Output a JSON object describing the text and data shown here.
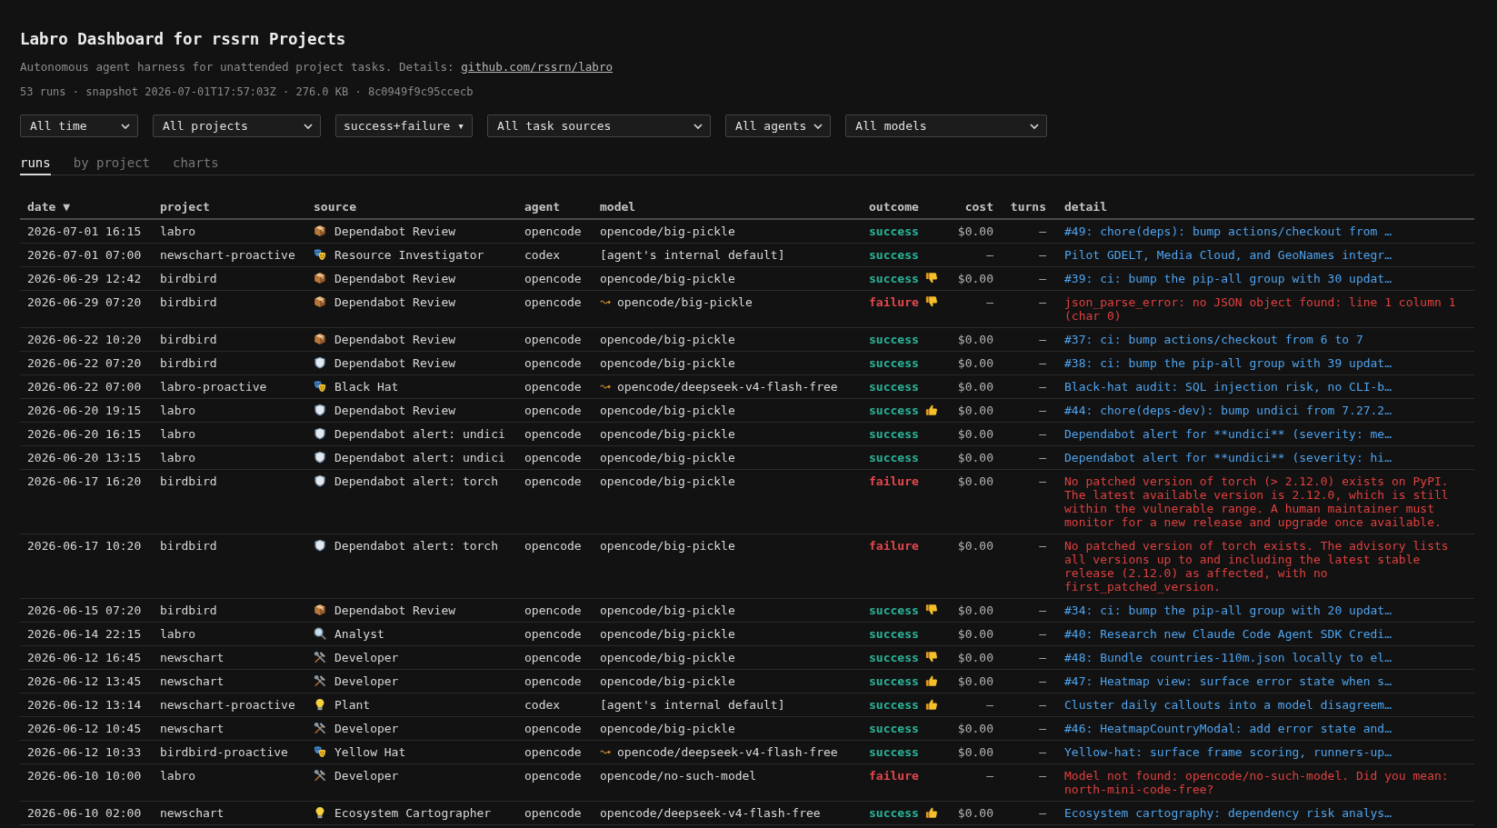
{
  "title": "Labro Dashboard for rssrn Projects",
  "description": {
    "text": "Autonomous agent harness for unattended project tasks. Details: ",
    "link": "github.com/rssrn/labro"
  },
  "snapshot": "53 runs · snapshot 2026-07-01T17:57:03Z · 276.0 KB · 8c0949f9c95ccecb",
  "filters": [
    {
      "kind": "select",
      "value": "All time"
    },
    {
      "kind": "select",
      "value": "All projects"
    },
    {
      "kind": "menu",
      "value": "success+failure ▾"
    },
    {
      "kind": "select",
      "value": "All task sources"
    },
    {
      "kind": "select",
      "value": "All agents"
    },
    {
      "kind": "select",
      "value": "All models"
    }
  ],
  "tabs": [
    {
      "label": "runs",
      "selected": true
    },
    {
      "label": "by project",
      "selected": false
    },
    {
      "label": "charts",
      "selected": false
    }
  ],
  "table": {
    "columns": [
      {
        "label": "date ▼",
        "kind": "text"
      },
      {
        "label": "project",
        "kind": "text"
      },
      {
        "label": "source",
        "kind": "text"
      },
      {
        "label": "agent",
        "kind": "text"
      },
      {
        "label": "model",
        "kind": "text"
      },
      {
        "label": "outcome",
        "kind": "text"
      },
      {
        "label": "cost",
        "kind": "number"
      },
      {
        "label": "turns",
        "kind": "number"
      },
      {
        "label": "detail",
        "kind": "text"
      }
    ],
    "rows": [
      {
        "date": "2026-07-01 16:15",
        "project": "labro",
        "source": {
          "kind": "package",
          "label": "Dependabot Review"
        },
        "agent": "opencode",
        "fallback": false,
        "model": "opencode/big-pickle",
        "outcome": "success",
        "failed": false,
        "liked": false,
        "disliked": false,
        "cost": "$0.00",
        "turns": "—",
        "detail": "#49: chore(deps): bump actions/checkout from …"
      },
      {
        "date": "2026-07-01 07:00",
        "project": "newschart-proactive",
        "source": {
          "kind": "masks",
          "label": "Resource Investigator"
        },
        "agent": "codex",
        "fallback": false,
        "model": "[agent's internal default]",
        "outcome": "success",
        "failed": false,
        "liked": false,
        "disliked": false,
        "cost": "—",
        "turns": "—",
        "detail": "Pilot GDELT, Media Cloud, and GeoNames integr…"
      },
      {
        "date": "2026-06-29 12:42",
        "project": "birdbird",
        "source": {
          "kind": "package",
          "label": "Dependabot Review"
        },
        "agent": "opencode",
        "fallback": false,
        "model": "opencode/big-pickle",
        "outcome": "success",
        "failed": false,
        "liked": false,
        "disliked": true,
        "cost": "$0.00",
        "turns": "—",
        "detail": "#39: ci: bump the pip-all group with 30 updat…"
      },
      {
        "date": "2026-06-29 07:20",
        "project": "birdbird",
        "source": {
          "kind": "package",
          "label": "Dependabot Review"
        },
        "agent": "opencode",
        "fallback": true,
        "model": "opencode/big-pickle",
        "outcome": "failure",
        "failed": true,
        "liked": false,
        "disliked": true,
        "cost": "—",
        "turns": "—",
        "detail": "json_parse_error: no JSON object found: line 1 column 1 (char 0)"
      },
      {
        "date": "2026-06-22 10:20",
        "project": "birdbird",
        "source": {
          "kind": "package",
          "label": "Dependabot Review"
        },
        "agent": "opencode",
        "fallback": false,
        "model": "opencode/big-pickle",
        "outcome": "success",
        "failed": false,
        "liked": false,
        "disliked": false,
        "cost": "$0.00",
        "turns": "—",
        "detail": "#37: ci: bump actions/checkout from 6 to 7"
      },
      {
        "date": "2026-06-22 07:20",
        "project": "birdbird",
        "source": {
          "kind": "shield",
          "label": "Dependabot Review"
        },
        "agent": "opencode",
        "fallback": false,
        "model": "opencode/big-pickle",
        "outcome": "success",
        "failed": false,
        "liked": false,
        "disliked": false,
        "cost": "$0.00",
        "turns": "—",
        "detail": "#38: ci: bump the pip-all group with 39 updat…"
      },
      {
        "date": "2026-06-22 07:00",
        "project": "labro-proactive",
        "source": {
          "kind": "masks",
          "label": "Black Hat"
        },
        "agent": "opencode",
        "fallback": true,
        "model": "opencode/deepseek-v4-flash-free",
        "outcome": "success",
        "failed": false,
        "liked": false,
        "disliked": false,
        "cost": "$0.00",
        "turns": "—",
        "detail": "Black-hat audit: SQL injection risk, no CLI-b…"
      },
      {
        "date": "2026-06-20 19:15",
        "project": "labro",
        "source": {
          "kind": "shield",
          "label": "Dependabot Review"
        },
        "agent": "opencode",
        "fallback": false,
        "model": "opencode/big-pickle",
        "outcome": "success",
        "failed": false,
        "liked": true,
        "disliked": false,
        "cost": "$0.00",
        "turns": "—",
        "detail": "#44: chore(deps-dev): bump undici from 7.27.2…"
      },
      {
        "date": "2026-06-20 16:15",
        "project": "labro",
        "source": {
          "kind": "shield",
          "label": "Dependabot alert: undici"
        },
        "agent": "opencode",
        "fallback": false,
        "model": "opencode/big-pickle",
        "outcome": "success",
        "failed": false,
        "liked": false,
        "disliked": false,
        "cost": "$0.00",
        "turns": "—",
        "detail": "Dependabot alert for **undici** (severity: me…"
      },
      {
        "date": "2026-06-20 13:15",
        "project": "labro",
        "source": {
          "kind": "shield",
          "label": "Dependabot alert: undici"
        },
        "agent": "opencode",
        "fallback": false,
        "model": "opencode/big-pickle",
        "outcome": "success",
        "failed": false,
        "liked": false,
        "disliked": false,
        "cost": "$0.00",
        "turns": "—",
        "detail": "Dependabot alert for **undici** (severity: hi…"
      },
      {
        "date": "2026-06-17 16:20",
        "project": "birdbird",
        "source": {
          "kind": "shield",
          "label": "Dependabot alert: torch"
        },
        "agent": "opencode",
        "fallback": false,
        "model": "opencode/big-pickle",
        "outcome": "failure",
        "failed": true,
        "liked": false,
        "disliked": false,
        "cost": "$0.00",
        "turns": "—",
        "detail": "No patched version of torch (> 2.12.0) exists on PyPI. The latest available version is 2.12.0, which is still within the vulnerable range. A human maintainer must monitor for a new release and upgrade once available."
      },
      {
        "date": "2026-06-17 10:20",
        "project": "birdbird",
        "source": {
          "kind": "shield",
          "label": "Dependabot alert: torch"
        },
        "agent": "opencode",
        "fallback": false,
        "model": "opencode/big-pickle",
        "outcome": "failure",
        "failed": true,
        "liked": false,
        "disliked": false,
        "cost": "$0.00",
        "turns": "—",
        "detail": "No patched version of torch exists. The advisory lists all versions up to and including the latest stable release (2.12.0) as affected, with no first_patched_version."
      },
      {
        "date": "2026-06-15 07:20",
        "project": "birdbird",
        "source": {
          "kind": "package",
          "label": "Dependabot Review"
        },
        "agent": "opencode",
        "fallback": false,
        "model": "opencode/big-pickle",
        "outcome": "success",
        "failed": false,
        "liked": false,
        "disliked": true,
        "cost": "$0.00",
        "turns": "—",
        "detail": "#34: ci: bump the pip-all group with 20 updat…"
      },
      {
        "date": "2026-06-14 22:15",
        "project": "labro",
        "source": {
          "kind": "magnifier",
          "label": "Analyst"
        },
        "agent": "opencode",
        "fallback": false,
        "model": "opencode/big-pickle",
        "outcome": "success",
        "failed": false,
        "liked": false,
        "disliked": false,
        "cost": "$0.00",
        "turns": "—",
        "detail": "#40: Research new Claude Code Agent SDK Credi…"
      },
      {
        "date": "2026-06-12 16:45",
        "project": "newschart",
        "source": {
          "kind": "tools",
          "label": "Developer"
        },
        "agent": "opencode",
        "fallback": false,
        "model": "opencode/big-pickle",
        "outcome": "success",
        "failed": false,
        "liked": false,
        "disliked": true,
        "cost": "$0.00",
        "turns": "—",
        "detail": "#48: Bundle countries-110m.json locally to el…"
      },
      {
        "date": "2026-06-12 13:45",
        "project": "newschart",
        "source": {
          "kind": "tools",
          "label": "Developer"
        },
        "agent": "opencode",
        "fallback": false,
        "model": "opencode/big-pickle",
        "outcome": "success",
        "failed": false,
        "liked": true,
        "disliked": false,
        "cost": "$0.00",
        "turns": "—",
        "detail": "#47: Heatmap view: surface error state when s…"
      },
      {
        "date": "2026-06-12 13:14",
        "project": "newschart-proactive",
        "source": {
          "kind": "bulb",
          "label": "Plant"
        },
        "agent": "codex",
        "fallback": false,
        "model": "[agent's internal default]",
        "outcome": "success",
        "failed": false,
        "liked": true,
        "disliked": false,
        "cost": "—",
        "turns": "—",
        "detail": "Cluster daily callouts into a model disagreem…"
      },
      {
        "date": "2026-06-12 10:45",
        "project": "newschart",
        "source": {
          "kind": "tools",
          "label": "Developer"
        },
        "agent": "opencode",
        "fallback": false,
        "model": "opencode/big-pickle",
        "outcome": "success",
        "failed": false,
        "liked": false,
        "disliked": false,
        "cost": "$0.00",
        "turns": "—",
        "detail": "#46: HeatmapCountryModal: add error state and…"
      },
      {
        "date": "2026-06-12 10:33",
        "project": "birdbird-proactive",
        "source": {
          "kind": "masks",
          "label": "Yellow Hat"
        },
        "agent": "opencode",
        "fallback": true,
        "model": "opencode/deepseek-v4-flash-free",
        "outcome": "success",
        "failed": false,
        "liked": false,
        "disliked": false,
        "cost": "$0.00",
        "turns": "—",
        "detail": "Yellow-hat: surface frame scoring, runners-up…"
      },
      {
        "date": "2026-06-10 10:00",
        "project": "labro",
        "source": {
          "kind": "tools",
          "label": "Developer"
        },
        "agent": "opencode",
        "fallback": false,
        "model": "opencode/no-such-model",
        "outcome": "failure",
        "failed": true,
        "liked": false,
        "disliked": false,
        "cost": "—",
        "turns": "—",
        "detail": "Model not found: opencode/no-such-model. Did you mean: north-mini-code-free?"
      },
      {
        "date": "2026-06-10 02:00",
        "project": "newschart",
        "source": {
          "kind": "bulb",
          "label": "Ecosystem Cartographer"
        },
        "agent": "opencode",
        "fallback": false,
        "model": "opencode/deepseek-v4-flash-free",
        "outcome": "success",
        "failed": false,
        "liked": true,
        "disliked": false,
        "cost": "$0.00",
        "turns": "—",
        "detail": "Ecosystem cartography: dependency risk analys…"
      }
    ]
  }
}
